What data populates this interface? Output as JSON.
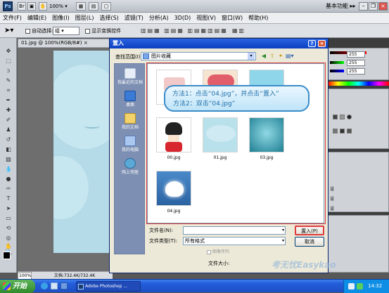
{
  "app_bar": {
    "logo": "Ps",
    "zoom": "100%",
    "workspace": "基本功能",
    "icons": [
      "bridge-icon",
      "mini-bridge-icon",
      "hand-icon",
      "zoom-icon",
      "view-extras-icon",
      "screen-mode-icon"
    ]
  },
  "menu": [
    "文件(F)",
    "编辑(E)",
    "图像(I)",
    "图层(L)",
    "选择(S)",
    "滤镜(T)",
    "分析(A)",
    "3D(D)",
    "视图(V)",
    "窗口(W)",
    "帮助(H)"
  ],
  "options_bar": {
    "auto_select_label": "自动选择:",
    "auto_select_value": "组",
    "show_transform_label": "显示变换控件"
  },
  "document": {
    "tab_title": "01.jpg @ 100%(RGB/8#)",
    "zoom": "100%",
    "doc_info": "文档:732.4K/732.4K"
  },
  "right_panel": {
    "values": [
      "255",
      "255",
      "255"
    ],
    "layer_labels": [
      "设",
      "设",
      "设"
    ]
  },
  "dialog": {
    "title": "置入",
    "look_in_label": "查找范围(I):",
    "look_in_value": "图片收藏",
    "places": [
      "我最近的文档",
      "桌面",
      "我的文档",
      "我的电脑",
      "网上邻居"
    ],
    "files": [
      {
        "name": "00.jpg"
      },
      {
        "name": "01.jpg"
      },
      {
        "name": "03.jpg"
      },
      {
        "name": "04.jpg"
      }
    ],
    "callout": {
      "line1": "方法1：点击“04.jpg”，并点击“置入”",
      "line2": "方法2：双击“04.jpg”"
    },
    "filename_label": "文件名(N):",
    "filetype_label": "文件类型(T):",
    "filetype_value": "所有格式",
    "image_sequence_label": "图像序列",
    "filesize_label": "文件大小:",
    "place_button": "置入(P)",
    "cancel_button": "取消"
  },
  "taskbar": {
    "start_label": "开始",
    "task_item": "Adobe Photoshop ...",
    "clock": "14:32"
  },
  "watermark": "考无忧Easykao"
}
